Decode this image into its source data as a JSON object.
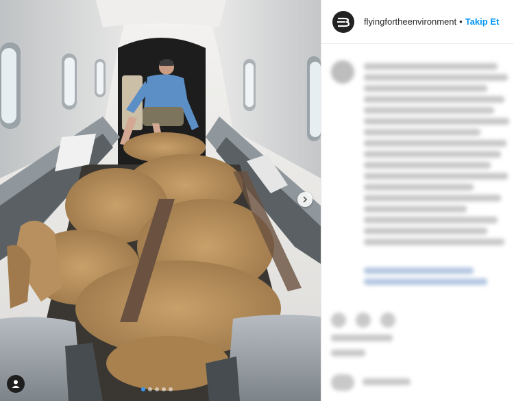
{
  "header": {
    "username": "flyingfortheenvironment",
    "separator": "•",
    "follow_label": "Takip Et"
  },
  "carousel": {
    "total_slides": 5,
    "active_slide": 1
  },
  "colors": {
    "accent": "#0095f6",
    "media_background": "#2b2f33"
  },
  "icons": {
    "logo": "brand-logo-icon",
    "user_tag": "user-tag-icon",
    "next": "chevron-right-icon"
  }
}
